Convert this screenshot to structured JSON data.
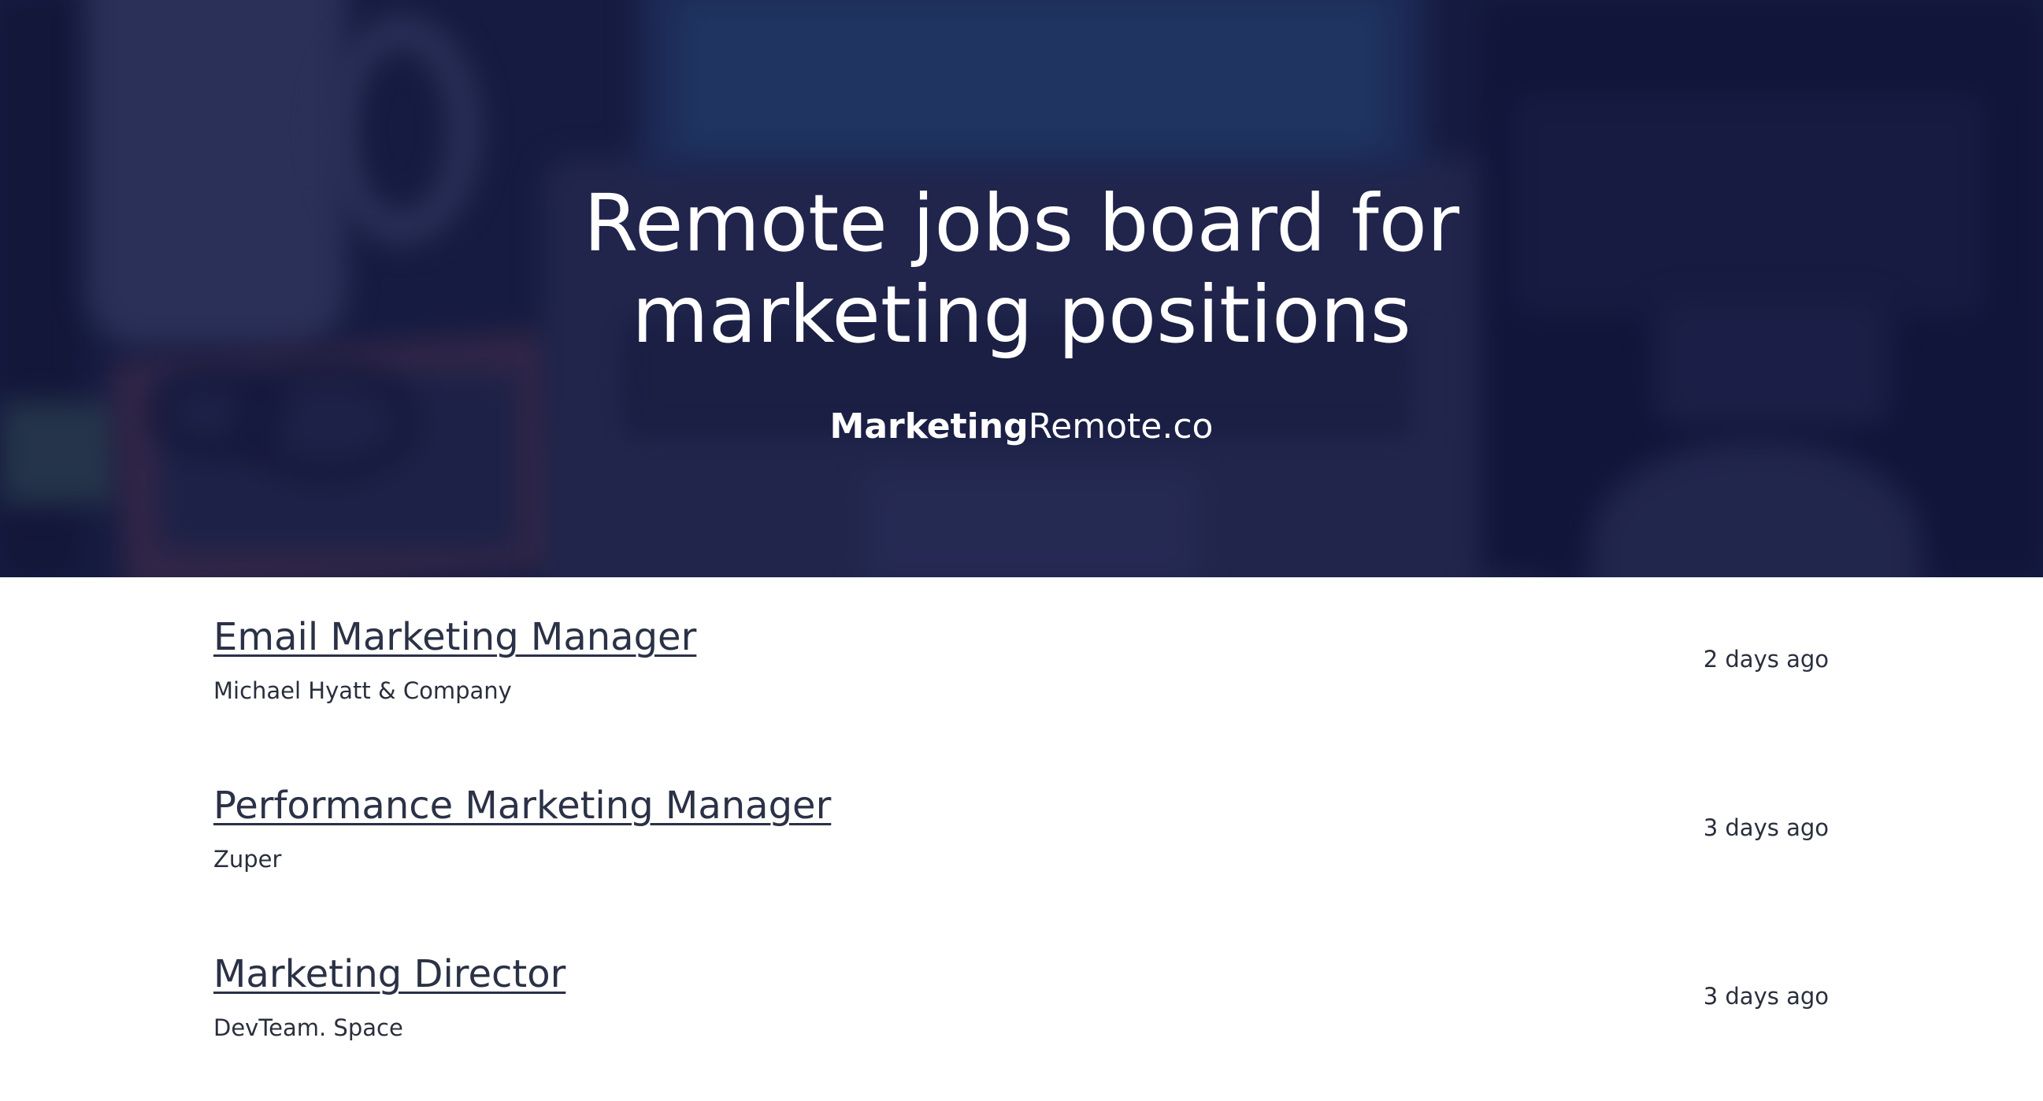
{
  "hero": {
    "title": "Remote jobs board for marketing positions",
    "brand_bold": "Marketing",
    "brand_light": "Remote.co"
  },
  "jobs": [
    {
      "title": "Email Marketing Manager",
      "company": "Michael Hyatt & Company",
      "posted": "2 days ago"
    },
    {
      "title": "Performance Marketing Manager",
      "company": "Zuper",
      "posted": "3 days ago"
    },
    {
      "title": "Marketing Director",
      "company": "DevTeam. Space",
      "posted": "3 days ago"
    }
  ],
  "colors": {
    "hero_overlay": "#12163c",
    "link_text": "#2b3146",
    "body_text": "#2a2f3d",
    "background": "#ffffff"
  }
}
